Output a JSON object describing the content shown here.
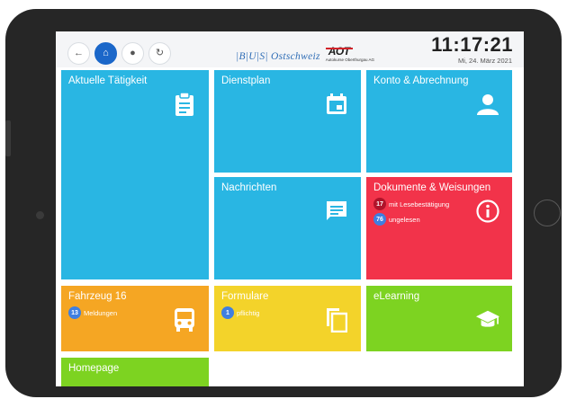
{
  "header": {
    "nav": [
      {
        "name": "back",
        "glyph": "←"
      },
      {
        "name": "home",
        "glyph": "⌂"
      },
      {
        "name": "user",
        "glyph": "●"
      },
      {
        "name": "refresh",
        "glyph": "↻"
      }
    ],
    "logo": {
      "bus_text": "|B|U|S| Ostschweiz",
      "aot_mark": "AOT",
      "aot_sub": "Autokurse Oberthurgau AG"
    },
    "clock": {
      "time": "11:17:21",
      "date": "Mi, 24. März 2021"
    }
  },
  "tiles": [
    {
      "id": "aktuelle-taetigkeit",
      "label": "Aktuelle Tätigkeit",
      "icon": "clipboard-icon",
      "color": "#29b6e3"
    },
    {
      "id": "dienstplan",
      "label": "Dienstplan",
      "icon": "calendar-icon",
      "color": "#29b6e3"
    },
    {
      "id": "konto-abrechnung",
      "label": "Konto & Abrechnung",
      "icon": "person-icon",
      "color": "#29b6e3"
    },
    {
      "id": "nachrichten",
      "label": "Nachrichten",
      "icon": "chat-icon",
      "color": "#29b6e3"
    },
    {
      "id": "dokumente-weisungen",
      "label": "Dokumente & Weisungen",
      "icon": "info-icon",
      "color": "#f2334a",
      "badges": [
        {
          "count": "17",
          "text": "mit Lesebestätigung",
          "badge_bg": "#b0132a",
          "badge_color": "#ffffff"
        },
        {
          "count": "76",
          "text": "ungelesen",
          "badge_bg": "#3f7fe0",
          "badge_color": "#ffffff"
        }
      ]
    },
    {
      "id": "fahrzeug",
      "label": "Fahrzeug 16",
      "icon": "bus-icon",
      "color": "#f5a623",
      "badges": [
        {
          "count": "13",
          "text": "Meldungen",
          "badge_bg": "#3f7fe0",
          "badge_color": "#ffffff"
        }
      ]
    },
    {
      "id": "formulare",
      "label": "Formulare",
      "icon": "copy-icon",
      "color": "#f3d32a",
      "badges": [
        {
          "count": "1",
          "text": "pflichtig",
          "badge_bg": "#3f7fe0",
          "badge_color": "#ffffff"
        }
      ]
    },
    {
      "id": "elearning",
      "label": "eLearning",
      "icon": "graduation-cap-icon",
      "color": "#7dd321"
    },
    {
      "id": "homepage",
      "label": "Homepage",
      "icon": "",
      "color": "#7dd321"
    }
  ]
}
